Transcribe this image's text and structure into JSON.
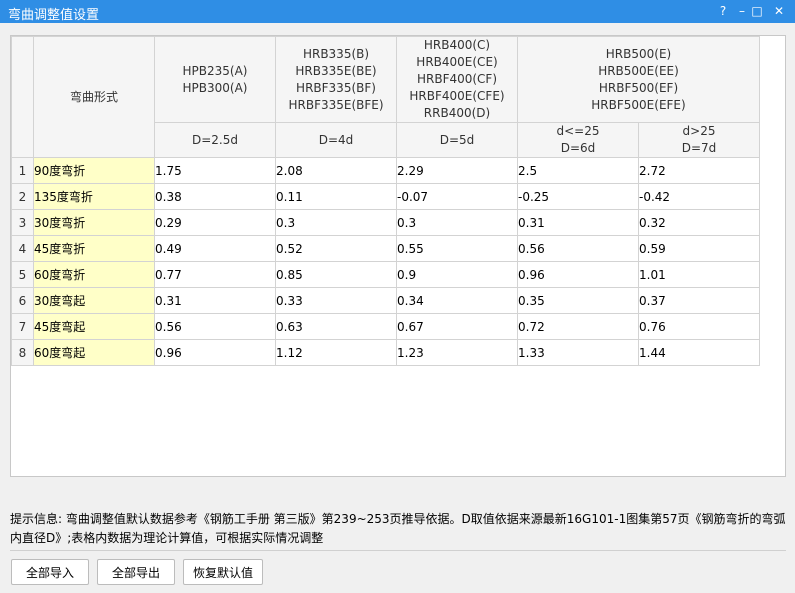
{
  "window": {
    "title": "弯曲调整值设置",
    "help_glyph": "?",
    "min_glyph": "–",
    "max_glyph": "□",
    "close_glyph": "✕"
  },
  "table": {
    "corner_label": "弯曲形式",
    "groups": [
      {
        "grade": "HPB235(A)\nHPB300(A)",
        "subs": [
          "D=2.5d"
        ]
      },
      {
        "grade": "HRB335(B)\nHRB335E(BE)\nHRBF335(BF)\nHRBF335E(BFE)",
        "subs": [
          "D=4d"
        ]
      },
      {
        "grade": "HRB400(C)\nHRB400E(CE)\nHRBF400(CF)\nHRBF400E(CFE)\nRRB400(D)",
        "subs": [
          "D=5d"
        ]
      },
      {
        "grade": "HRB500(E)\nHRB500E(EE)\nHRBF500(EF)\nHRBF500E(EFE)",
        "subs": [
          "d<=25\nD=6d",
          "d>25\nD=7d"
        ]
      }
    ],
    "rows": [
      {
        "no": "1",
        "type": "90度弯折",
        "values": [
          "1.75",
          "2.08",
          "2.29",
          "2.5",
          "2.72"
        ]
      },
      {
        "no": "2",
        "type": "135度弯折",
        "values": [
          "0.38",
          "0.11",
          "-0.07",
          "-0.25",
          "-0.42"
        ]
      },
      {
        "no": "3",
        "type": "30度弯折",
        "values": [
          "0.29",
          "0.3",
          "0.3",
          "0.31",
          "0.32"
        ]
      },
      {
        "no": "4",
        "type": "45度弯折",
        "values": [
          "0.49",
          "0.52",
          "0.55",
          "0.56",
          "0.59"
        ]
      },
      {
        "no": "5",
        "type": "60度弯折",
        "values": [
          "0.77",
          "0.85",
          "0.9",
          "0.96",
          "1.01"
        ]
      },
      {
        "no": "6",
        "type": "30度弯起",
        "values": [
          "0.31",
          "0.33",
          "0.34",
          "0.35",
          "0.37"
        ]
      },
      {
        "no": "7",
        "type": "45度弯起",
        "values": [
          "0.56",
          "0.63",
          "0.67",
          "0.72",
          "0.76"
        ]
      },
      {
        "no": "8",
        "type": "60度弯起",
        "values": [
          "0.96",
          "1.12",
          "1.23",
          "1.33",
          "1.44"
        ]
      }
    ]
  },
  "hint": "提示信息: 弯曲调整值默认数据参考《钢筋工手册 第三版》第239~253页推导依据。D取值依据来源最新16G101-1图集第57页《钢筋弯折的弯弧内直径D》;表格内数据为理论计算值，可根据实际情况调整",
  "buttons": {
    "import_all": "全部导入",
    "export_all": "全部导出",
    "restore_default": "恢复默认值"
  },
  "colors": {
    "titlebar": "#2f8ee5",
    "label_cell": "#ffffc8"
  }
}
